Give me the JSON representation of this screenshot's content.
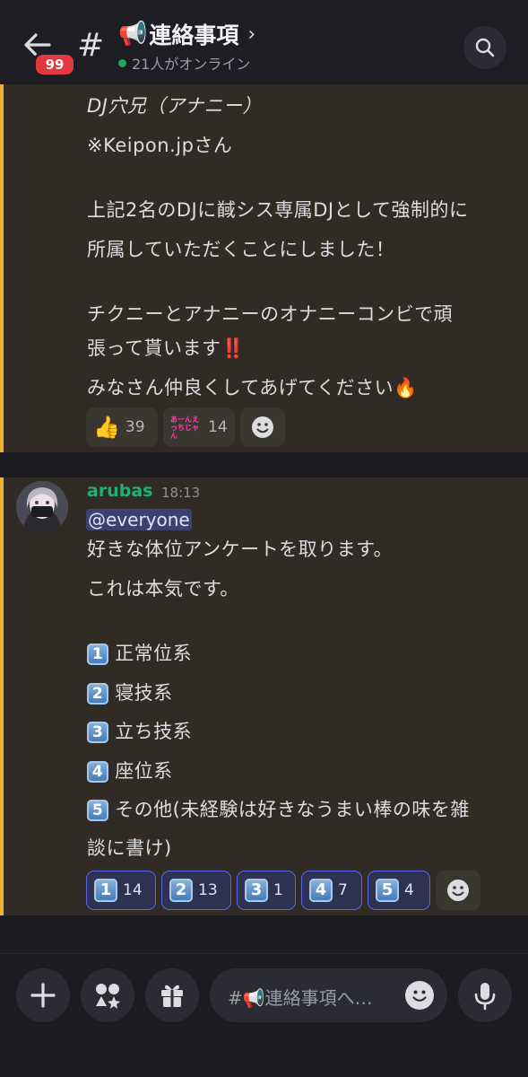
{
  "header": {
    "back_badge": "99",
    "channel_emoji": "📢",
    "title": "連絡事項",
    "online_text": "21人がオンライン"
  },
  "message1": {
    "lines": [
      "DJ穴兄（アナニー）",
      "※Keipon.jpさん",
      "上記2名のDJに馘シス専属DJとして強制的に",
      "所属していただくことにしました！",
      "チクニーとアナニーのオナニーコンビで頑",
      "張って貰います‼️",
      "みなさん仲良くしてあげてください🔥"
    ],
    "reactions": [
      {
        "emoji": "👍",
        "count": "39"
      },
      {
        "emoji": "あーんえっちじゃん",
        "count": "14"
      }
    ]
  },
  "message2": {
    "author": "arubas",
    "time": "18:13",
    "mention": "@everyone",
    "intro1": "好きな体位アンケートを取ります。",
    "intro2": "これは本気です。",
    "options": [
      {
        "key": "1",
        "text": "正常位系"
      },
      {
        "key": "2",
        "text": "寝技系"
      },
      {
        "key": "3",
        "text": "立ち技系"
      },
      {
        "key": "4",
        "text": "座位系"
      },
      {
        "key": "5",
        "text": "その他(未経験は好きなうまい棒の味を雑"
      }
    ],
    "option5_cont": "談に書け)",
    "reactions": [
      {
        "key": "1",
        "count": "14"
      },
      {
        "key": "2",
        "count": "13"
      },
      {
        "key": "3",
        "count": "1"
      },
      {
        "key": "4",
        "count": "7"
      },
      {
        "key": "5",
        "count": "4"
      }
    ]
  },
  "composer": {
    "placeholder": "#📢連絡事項へ…"
  },
  "colors": {
    "accent_bar": "#f0b232",
    "author": "#1fb07a",
    "badge": "#e2383f",
    "mention_bg": "#3c4270"
  }
}
